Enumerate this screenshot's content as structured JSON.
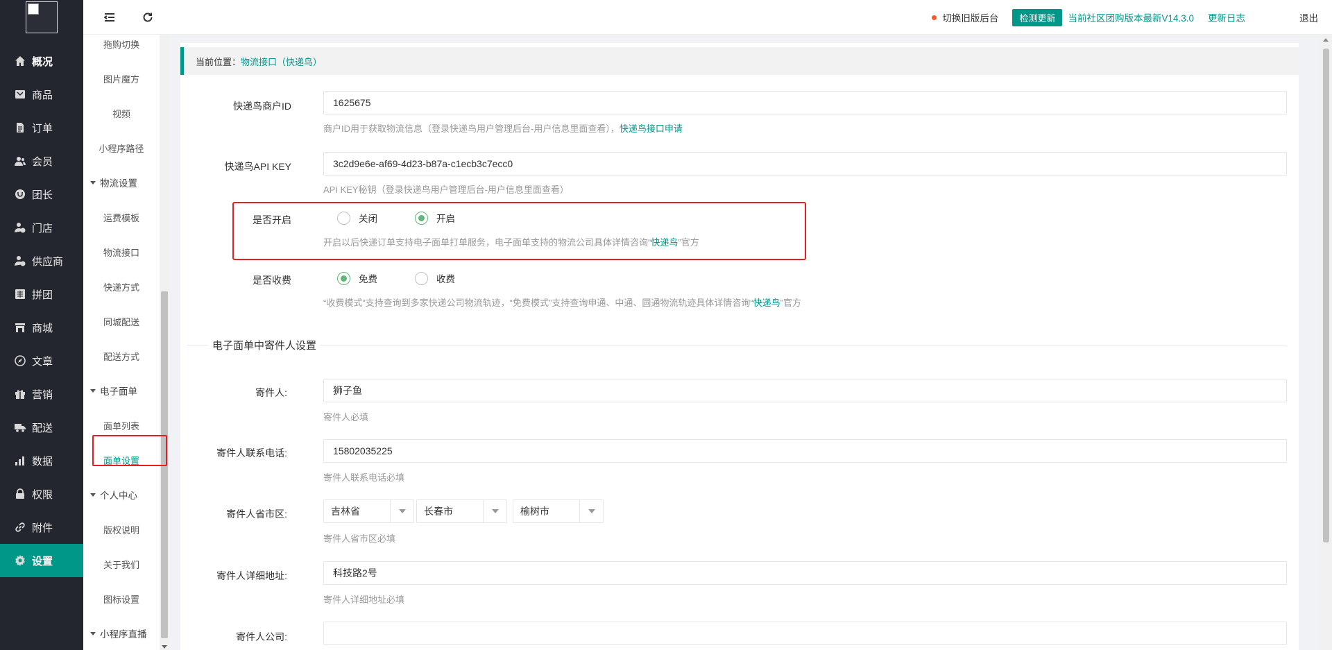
{
  "header": {
    "old_backend": "切换旧版后台",
    "check_update": "检测更新",
    "version_text": "当前社区团购版本最新V14.3.0",
    "changelog": "更新日志",
    "logout": "退出"
  },
  "sidebar": {
    "items": [
      {
        "label": "概况",
        "icon": "home-icon"
      },
      {
        "label": "商品",
        "icon": "goods-icon"
      },
      {
        "label": "订单",
        "icon": "order-icon"
      },
      {
        "label": "会员",
        "icon": "member-icon"
      },
      {
        "label": "团长",
        "icon": "leader-icon"
      },
      {
        "label": "门店",
        "icon": "store-icon"
      },
      {
        "label": "供应商",
        "icon": "supplier-icon"
      },
      {
        "label": "拼团",
        "icon": "group-buy-icon"
      },
      {
        "label": "商城",
        "icon": "mall-icon"
      },
      {
        "label": "文章",
        "icon": "compass-icon"
      },
      {
        "label": "营销",
        "icon": "gift-icon"
      },
      {
        "label": "配送",
        "icon": "truck-icon"
      },
      {
        "label": "数据",
        "icon": "chart-icon"
      },
      {
        "label": "权限",
        "icon": "lock-icon"
      },
      {
        "label": "附件",
        "icon": "link-icon"
      },
      {
        "label": "设置",
        "icon": "gear-icon"
      }
    ]
  },
  "submenu": {
    "items": [
      {
        "label": "拖购切换",
        "group": false
      },
      {
        "label": "图片魔方",
        "group": false
      },
      {
        "label": "视频",
        "group": false
      },
      {
        "label": "小程序路径",
        "group": false
      },
      {
        "label": "物流设置",
        "group": true
      },
      {
        "label": "运费模板",
        "group": false
      },
      {
        "label": "物流接口",
        "group": false
      },
      {
        "label": "快递方式",
        "group": false
      },
      {
        "label": "同城配送",
        "group": false
      },
      {
        "label": "配送方式",
        "group": false
      },
      {
        "label": "电子面单",
        "group": true
      },
      {
        "label": "面单列表",
        "group": false
      },
      {
        "label": "面单设置",
        "group": false,
        "selected": true
      },
      {
        "label": "个人中心",
        "group": true
      },
      {
        "label": "版权说明",
        "group": false
      },
      {
        "label": "关于我们",
        "group": false
      },
      {
        "label": "图标设置",
        "group": false
      },
      {
        "label": "小程序直播",
        "group": true
      }
    ]
  },
  "breadcrumb": {
    "prefix": "当前位置：",
    "current": "物流接口（快递鸟）"
  },
  "form": {
    "merchant_id": {
      "label": "快递鸟商户ID",
      "value": "1625675",
      "hint": "商户ID用于获取物流信息（登录快递鸟用户管理后台-用户信息里面查看），",
      "hint_link": "快递鸟接口申请"
    },
    "api_key": {
      "label": "快递鸟API KEY",
      "value": "3c2d9e6e-af69-4d23-b87a-c1ecb3c7ecc0",
      "hint": "API KEY秘钥（登录快递鸟用户管理后台-用户信息里面查看）"
    },
    "enabled": {
      "label": "是否开启",
      "option_off": "关闭",
      "option_on": "开启",
      "selected": "开启",
      "hint_before": "开启以后快递订单支持电子面单打单服务，电子面单支持的物流公司具体详情咨询“",
      "hint_link": "快递鸟",
      "hint_after": "”官方"
    },
    "charge": {
      "label": "是否收费",
      "option_free": "免费",
      "option_paid": "收费",
      "selected": "免费",
      "hint_before": "“收费模式”支持查询到多家快递公司物流轨迹，“免费模式”支持查询申通、中通、圆通物流轨迹具体详情咨询“",
      "hint_link": "快递鸟",
      "hint_after": "”官方"
    },
    "section_title": "电子面单中寄件人设置",
    "sender_name": {
      "label": "寄件人:",
      "value": "狮子鱼",
      "hint": "寄件人必填"
    },
    "sender_phone": {
      "label": "寄件人联系电话:",
      "value": "15802035225",
      "hint": "寄件人联系电话必填"
    },
    "sender_region": {
      "label": "寄件人省市区:",
      "province": "吉林省",
      "city": "长春市",
      "district": "榆树市",
      "hint": "寄件人省市区必填"
    },
    "sender_address": {
      "label": "寄件人详细地址:",
      "value": "科技路2号",
      "hint": "寄件人详细地址必填"
    },
    "sender_company": {
      "label": "寄件人公司:",
      "value": ""
    }
  },
  "colors": {
    "accent": "#009688",
    "sidebar_bg": "#23262e",
    "radio_on": "#5fb878",
    "highlight": "#e31e24"
  }
}
